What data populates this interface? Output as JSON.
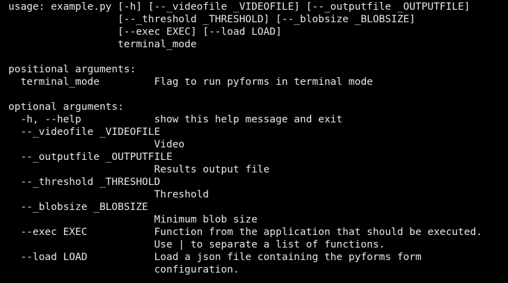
{
  "terminal": {
    "text_color": "#e8e8e8",
    "background_color": "#000000",
    "lines": [
      "usage: example.py [-h] [--_videofile _VIDEOFILE] [--_outputfile _OUTPUTFILE]",
      "                  [--_threshold _THRESHOLD] [--_blobsize _BLOBSIZE]",
      "                  [--exec EXEC] [--load LOAD]",
      "                  terminal_mode",
      "",
      "positional arguments:",
      "  terminal_mode         Flag to run pyforms in terminal mode",
      "",
      "optional arguments:",
      "  -h, --help            show this help message and exit",
      "  --_videofile _VIDEOFILE",
      "                        Video",
      "  --_outputfile _OUTPUTFILE",
      "                        Results output file",
      "  --_threshold _THRESHOLD",
      "                        Threshold",
      "  --_blobsize _BLOBSIZE",
      "                        Minimum blob size",
      "  --exec EXEC           Function from the application that should be executed.",
      "                        Use | to separate a list of functions.",
      "  --load LOAD           Load a json file containing the pyforms form",
      "                        configuration."
    ]
  }
}
